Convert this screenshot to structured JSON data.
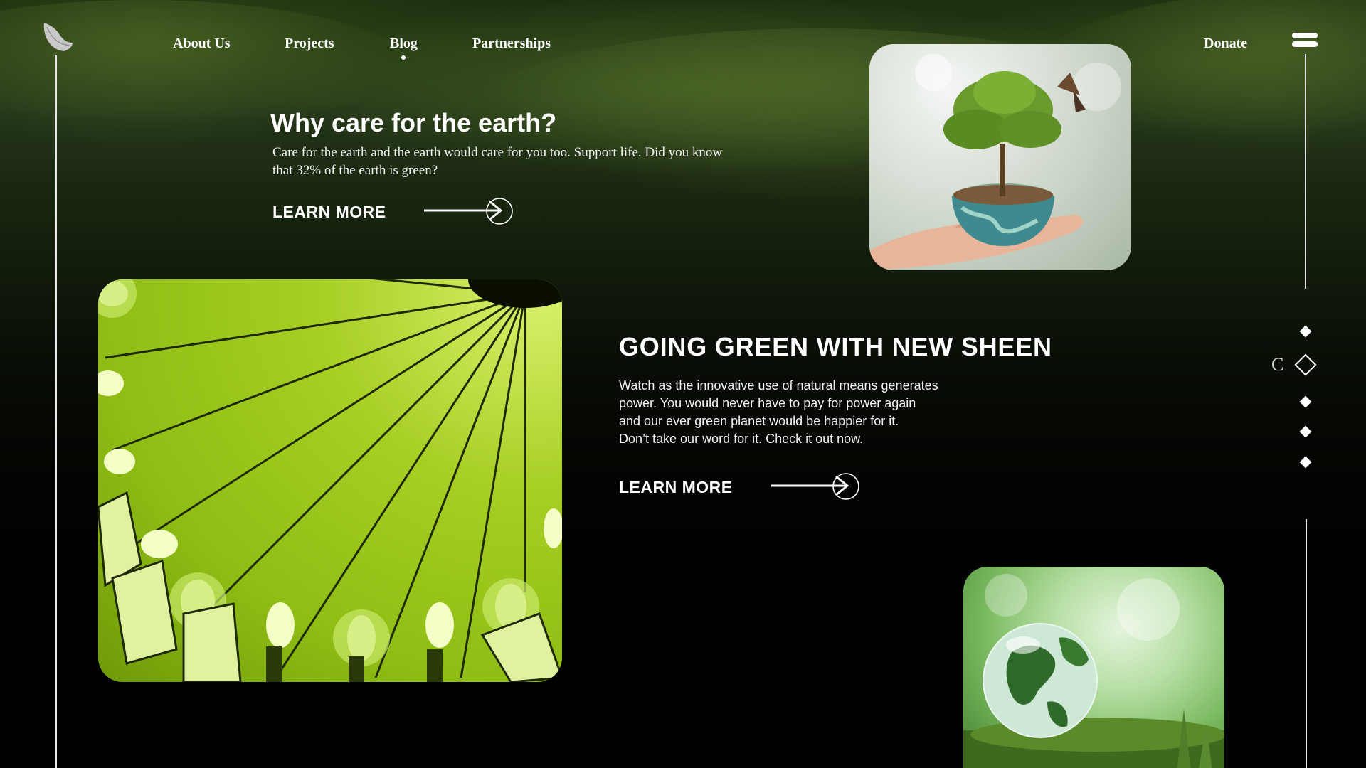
{
  "nav": {
    "items": [
      {
        "label": "About Us",
        "active": false
      },
      {
        "label": "Projects",
        "active": false
      },
      {
        "label": "Blog",
        "active": true
      },
      {
        "label": "Partnerships",
        "active": false
      }
    ],
    "donate_label": "Donate"
  },
  "section1": {
    "title": "Why care for the earth?",
    "body": "Care for the earth and the earth would care for you too. Support life. Did you know that 32% of the earth is green?",
    "cta_label": "LEARN MORE"
  },
  "section2": {
    "title": "GOING GREEN WITH NEW SHEEN",
    "body_lines": [
      "Watch as the innovative use of natural means generates",
      "power. You would never have to pay for power again",
      "and our ever green planet would be happier for it.",
      "Don’t take our word for it. Check it out now."
    ],
    "cta_label": "LEARN MORE"
  },
  "pager": {
    "current_letter": "C",
    "count": 5,
    "active_index": 1
  },
  "icons": {
    "logo": "leaf-logo-icon",
    "menu": "hamburger-menu-icon",
    "arrow": "arrow-right-circle-icon"
  },
  "images": {
    "top_right": "hand-holding-tree-on-globe",
    "left": "green-light-bulbs-radiating",
    "bottom_right": "glass-globe-in-moss"
  },
  "colors": {
    "background": "#000000",
    "text": "#ffffff",
    "accent_green": "#a7cf24"
  }
}
